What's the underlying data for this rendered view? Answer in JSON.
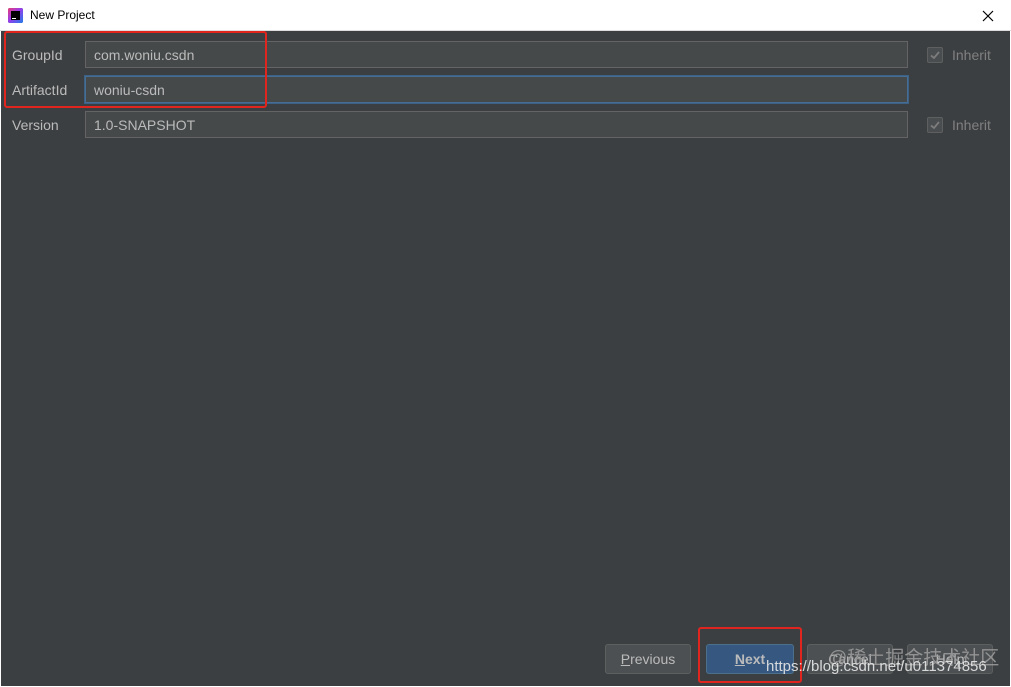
{
  "window": {
    "title": "New Project",
    "app_icon": "intellij-idea-icon",
    "close_icon": "close-icon"
  },
  "form": {
    "group_id": {
      "label": "GroupId",
      "value": "com.woniu.csdn",
      "inherit_label": "Inherit",
      "inherit_checked": true
    },
    "artifact_id": {
      "label": "ArtifactId",
      "value": "woniu-csdn"
    },
    "version": {
      "label": "Version",
      "value": "1.0-SNAPSHOT",
      "inherit_label": "Inherit",
      "inherit_checked": true
    }
  },
  "buttons": {
    "previous": {
      "mnemonic": "P",
      "rest": "revious"
    },
    "next": {
      "mnemonic": "N",
      "rest": "ext"
    },
    "cancel": "Cancel",
    "help": "Help"
  },
  "watermark": {
    "line1": "@稀土掘金技术社区",
    "line2": "https://blog.csdn.net/u011374856"
  },
  "colors": {
    "background": "#3c3f41",
    "input_background": "#45494a",
    "annotation_red": "#e0251f",
    "default_button": "#365880"
  }
}
